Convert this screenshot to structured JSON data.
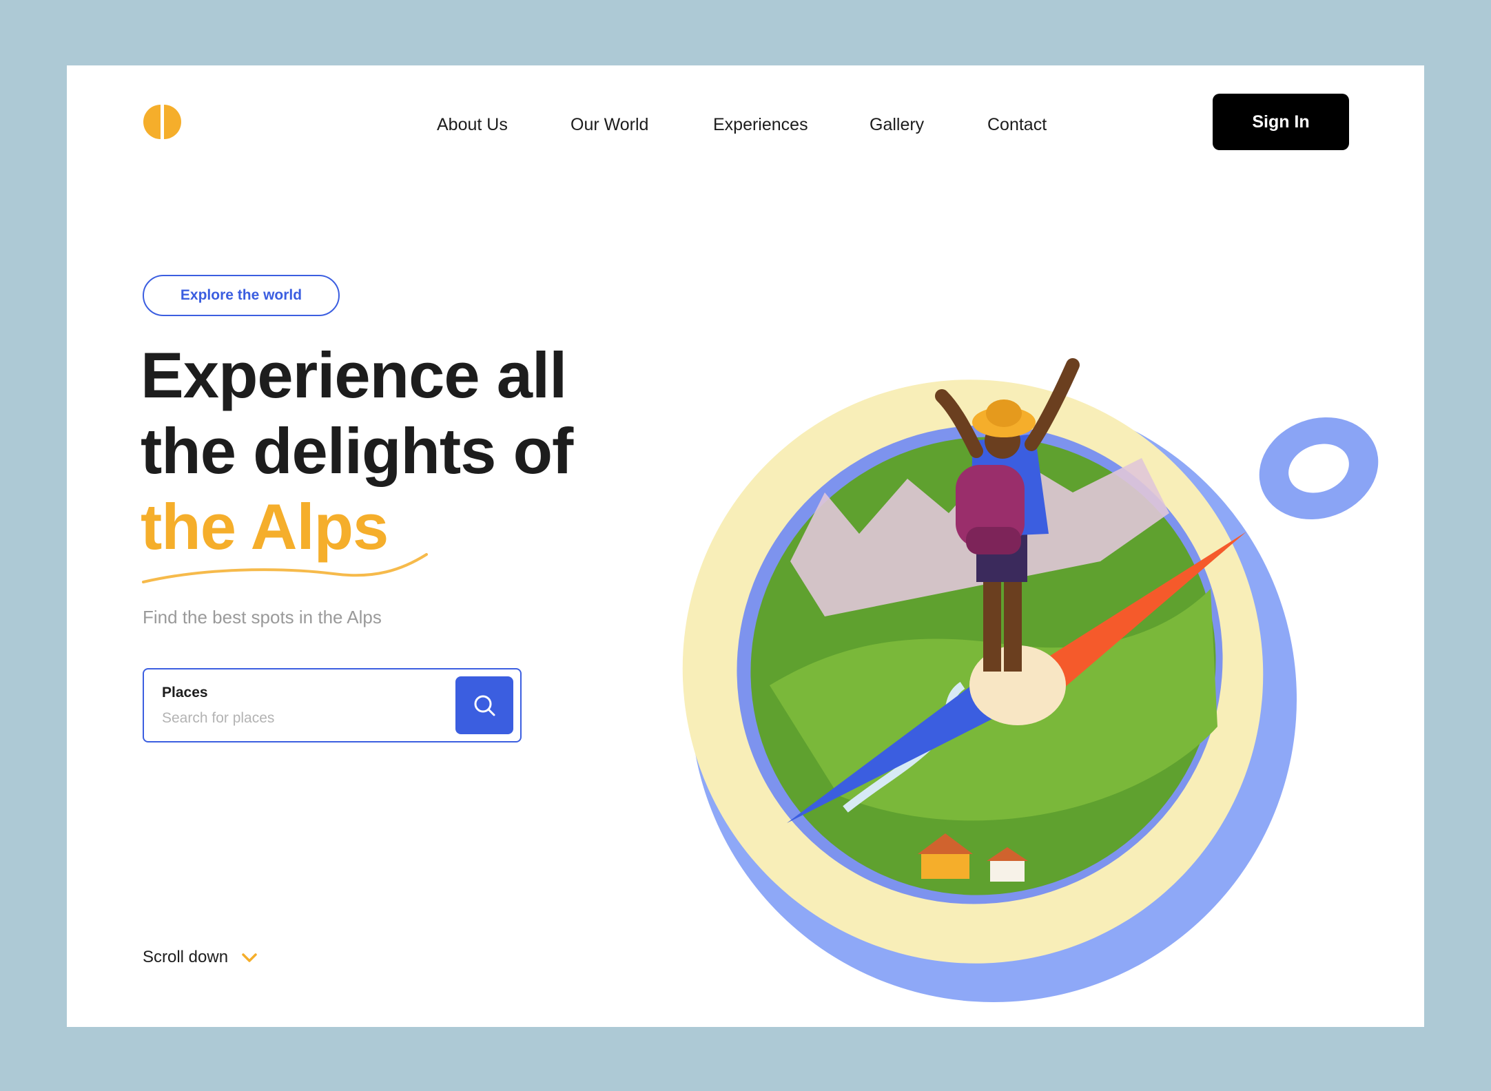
{
  "header": {
    "logo": "half-circle-logo",
    "nav": [
      {
        "label": "About Us"
      },
      {
        "label": "Our World"
      },
      {
        "label": "Experiences"
      },
      {
        "label": "Gallery"
      },
      {
        "label": "Contact"
      }
    ],
    "signin_label": "Sign In"
  },
  "hero": {
    "badge": "Explore the world",
    "headline": {
      "line1": "Experience all",
      "line2": "the delights of",
      "line3": "the Alps"
    },
    "subtitle": "Find the best spots in the Alps",
    "search": {
      "label": "Places",
      "placeholder": "Search for places",
      "button_icon": "search-icon"
    },
    "scroll_label": "Scroll down",
    "illustration": "hiker-on-compass-illustration"
  },
  "colors": {
    "background": "#adc9d5",
    "accent": "#f5ae2b",
    "primary": "#3b5ee0",
    "dark": "#000000"
  }
}
